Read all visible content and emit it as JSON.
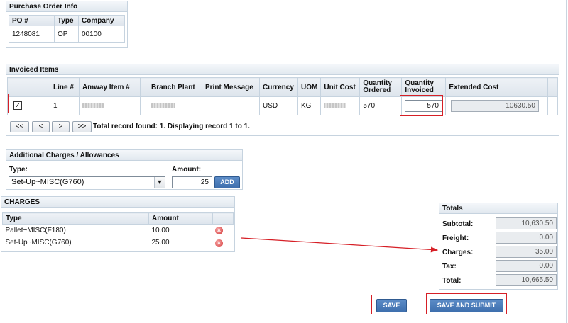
{
  "po_info": {
    "title": "Purchase Order Info",
    "headers": [
      "PO #",
      "Type",
      "Company"
    ],
    "row": [
      "1248081",
      "OP",
      "00100"
    ]
  },
  "invoiced_items": {
    "title": "Invoiced Items",
    "headers": [
      "Line #",
      "Amway Item #",
      "Branch Plant",
      "Print Message",
      "Currency",
      "UOM",
      "Unit Cost",
      "Quantity Ordered",
      "Quantity Invoiced",
      "Extended Cost"
    ],
    "row": {
      "checked": true,
      "line": "1",
      "currency": "USD",
      "uom": "KG",
      "qty_ordered": "570",
      "qty_invoiced": "570",
      "extended_cost": "10630.50"
    },
    "pager": {
      "first": "<<",
      "prev": "<",
      "next": ">",
      "last": ">>",
      "status": "Total record found: 1. Displaying record 1 to 1."
    }
  },
  "additional": {
    "title": "Additional Charges / Allowances",
    "type_label": "Type:",
    "type_value": "Set-Up~MISC(G760)",
    "amount_label": "Amount:",
    "amount_value": "25",
    "add_button": "ADD"
  },
  "charges": {
    "title": "CHARGES",
    "headers": [
      "Type",
      "Amount"
    ],
    "rows": [
      {
        "type": "Pallet~MISC(F180)",
        "amount": "10.00"
      },
      {
        "type": "Set-Up~MISC(G760)",
        "amount": "25.00"
      }
    ]
  },
  "totals": {
    "title": "Totals",
    "subtotal_label": "Subtotal:",
    "subtotal": "10,630.50",
    "freight_label": "Freight:",
    "freight": "0.00",
    "charges_label": "Charges:",
    "charges": "35.00",
    "tax_label": "Tax:",
    "tax": "0.00",
    "total_label": "Total:",
    "total": "10,665.50"
  },
  "actions": {
    "save": "SAVE",
    "save_submit": "SAVE AND SUBMIT"
  },
  "colors": {
    "annotation_red": "#d61f26",
    "button_blue": "#3e6fae"
  }
}
